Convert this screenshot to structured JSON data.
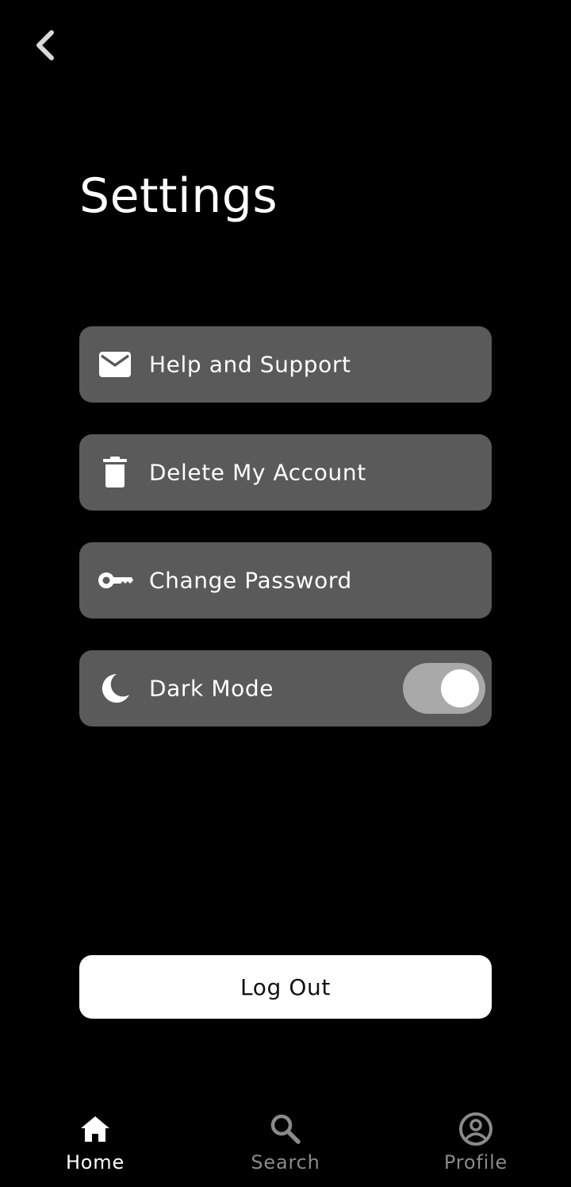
{
  "header": {
    "back_icon": "chevron-left-icon",
    "title": "Settings"
  },
  "menu": {
    "items": [
      {
        "label": "Help and Support",
        "icon": "mail-icon"
      },
      {
        "label": "Delete My Account",
        "icon": "trash-icon"
      },
      {
        "label": "Change Password",
        "icon": "key-icon"
      },
      {
        "label": "Dark Mode",
        "icon": "moon-icon"
      }
    ],
    "dark_mode_enabled": true
  },
  "logout": {
    "label": "Log Out"
  },
  "bottom_nav": {
    "items": [
      {
        "label": "Home",
        "icon": "home-icon",
        "active": true
      },
      {
        "label": "Search",
        "icon": "search-icon",
        "active": false
      },
      {
        "label": "Profile",
        "icon": "profile-icon",
        "active": false
      }
    ]
  },
  "colors": {
    "background": "#000000",
    "card": "#5a5a5a",
    "toggle_track": "#a9a9a9",
    "inactive_nav": "#8a8a8a"
  }
}
